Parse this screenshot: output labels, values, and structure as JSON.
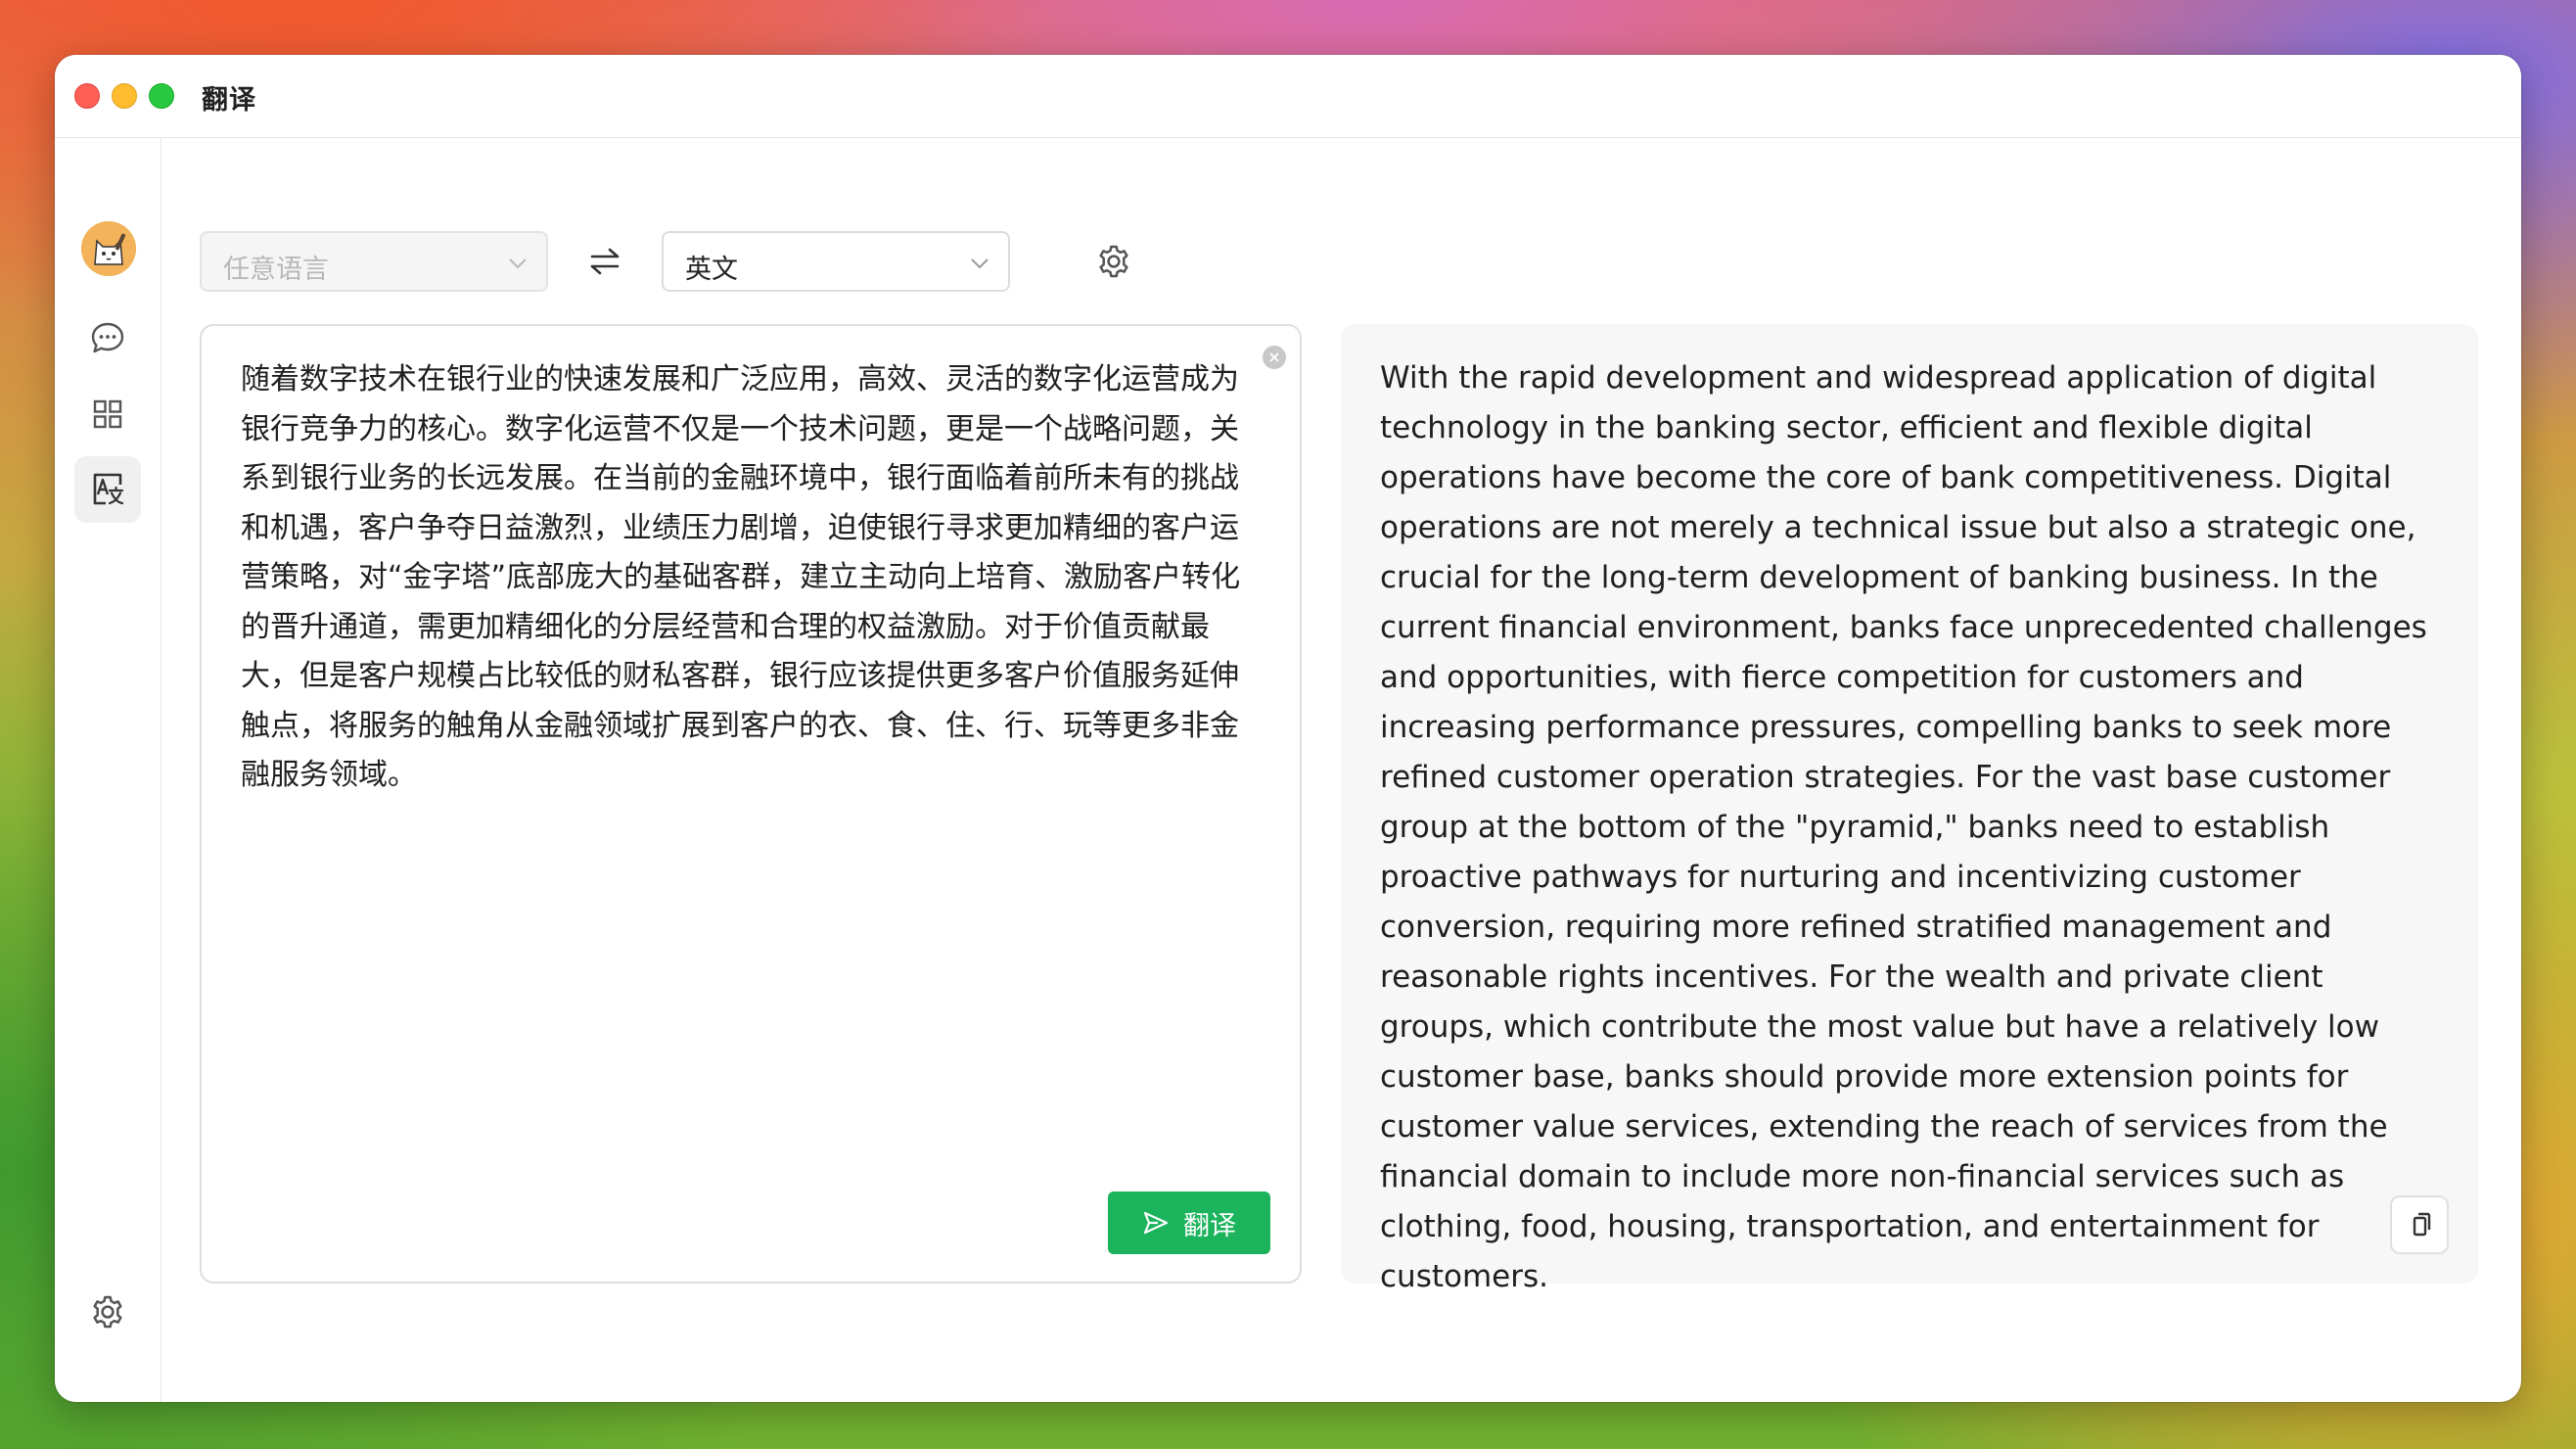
{
  "window": {
    "title": "翻译"
  },
  "sidebar": {
    "items": [
      {
        "name": "chat",
        "icon": "chat-bubble-icon"
      },
      {
        "name": "apps",
        "icon": "grid-icon"
      },
      {
        "name": "translate",
        "icon": "translate-icon",
        "active": true
      }
    ],
    "settings_icon": "gear-icon"
  },
  "toolbar": {
    "source_language": "任意语言",
    "target_language": "英文",
    "swap_icon": "swap-arrows-icon",
    "settings_icon": "gear-icon"
  },
  "source": {
    "text": "随着数字技术在银行业的快速发展和广泛应用，高效、灵活的数字化运营成为银行竞争力的核心。数字化运营不仅是一个技术问题，更是一个战略问题，关系到银行业务的长远发展。在当前的金融环境中，银行面临着前所未有的挑战和机遇，客户争夺日益激烈，业绩压力剧增，迫使银行寻求更加精细的客户运营策略，对“金字塔”底部庞大的基础客群，建立主动向上培育、激励客户转化的晋升通道，需更加精细化的分层经营和合理的权益激励。对于价值贡献最大，但是客户规模占比较低的财私客群，银行应该提供更多客户价值服务延伸触点，将服务的触角从金融领域扩展到客户的衣、食、住、行、玩等更多非金融服务领域。",
    "translate_button": "翻译"
  },
  "result": {
    "text": "With the rapid development and widespread application of digital technology in the banking sector, efficient and flexible digital operations have become the core of bank competitiveness. Digital operations are not merely a technical issue but also a strategic one, crucial for the long-term development of banking business. In the current financial environment, banks face unprecedented challenges and opportunities, with fierce competition for customers and increasing performance pressures, compelling banks to seek more refined customer operation strategies. For the vast base customer group at the bottom of the \"pyramid,\" banks need to establish proactive pathways for nurturing and incentivizing customer conversion, requiring more refined stratified management and reasonable rights incentives. For the wealth and private client groups, which contribute the most value but have a relatively low customer base, banks should provide more extension points for customer value services, extending the reach of services from the financial domain to include more non-financial services such as clothing, food, housing, transportation, and entertainment for customers."
  },
  "colors": {
    "accent": "#1bb35c",
    "traffic_red": "#fe5f57",
    "traffic_yellow": "#febc2e",
    "traffic_green": "#28c840"
  }
}
